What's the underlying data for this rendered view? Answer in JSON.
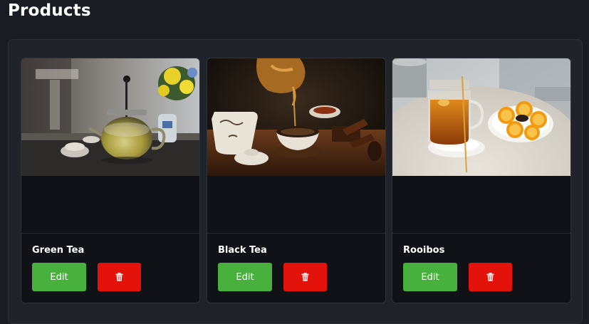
{
  "page": {
    "title": "Products"
  },
  "products": [
    {
      "name": "Green Tea",
      "edit_label": "Edit",
      "delete_icon": "trash-icon"
    },
    {
      "name": "Black Tea",
      "edit_label": "Edit",
      "delete_icon": "trash-icon"
    },
    {
      "name": "Rooibos",
      "edit_label": "Edit",
      "delete_icon": "trash-icon"
    }
  ],
  "colors": {
    "background": "#191c22",
    "panel": "#20232a",
    "card": "#101218",
    "edit_button": "#48b13d",
    "delete_button": "#e3120b"
  }
}
